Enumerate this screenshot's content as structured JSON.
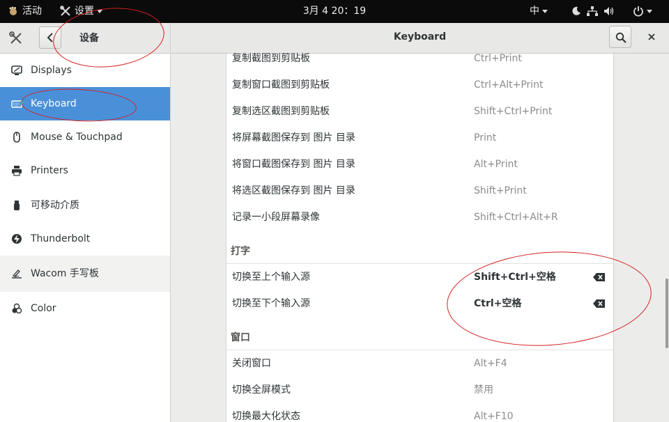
{
  "topbar": {
    "activities": "活动",
    "app_menu": "设置",
    "clock": "3月 4  20：19",
    "input_method": "中"
  },
  "header": {
    "section": "设备",
    "title": "Keyboard"
  },
  "sidebar": {
    "items": [
      {
        "label": "Displays",
        "icon": "display-icon"
      },
      {
        "label": "Keyboard",
        "icon": "keyboard-icon"
      },
      {
        "label": "Mouse & Touchpad",
        "icon": "mouse-icon"
      },
      {
        "label": "Printers",
        "icon": "printer-icon"
      },
      {
        "label": "可移动介质",
        "icon": "usb-icon"
      },
      {
        "label": "Thunderbolt",
        "icon": "thunderbolt-icon"
      },
      {
        "label": "Wacom 手写板",
        "icon": "tablet-icon"
      },
      {
        "label": "Color",
        "icon": "color-icon"
      }
    ]
  },
  "shortcuts": {
    "screenshots": [
      {
        "name": "复制截图到剪贴板",
        "accel": "Ctrl+Print"
      },
      {
        "name": "复制窗口截图到剪贴板",
        "accel": "Ctrl+Alt+Print"
      },
      {
        "name": "复制选区截图到剪贴板",
        "accel": "Shift+Ctrl+Print"
      },
      {
        "name": "将屏幕截图保存到 图片 目录",
        "accel": "Print"
      },
      {
        "name": "将窗口截图保存到 图片 目录",
        "accel": "Alt+Print"
      },
      {
        "name": "将选区截图保存到 图片 目录",
        "accel": "Shift+Print"
      },
      {
        "name": "记录一小段屏幕录像",
        "accel": "Shift+Ctrl+Alt+R"
      }
    ],
    "typing_group": "打字",
    "typing": [
      {
        "name": "切换至上个输入源",
        "accel": "Shift+Ctrl+空格"
      },
      {
        "name": "切换至下个输入源",
        "accel": "Ctrl+空格"
      }
    ],
    "windows_group": "窗口",
    "windows": [
      {
        "name": "关闭窗口",
        "accel": "Alt+F4"
      },
      {
        "name": "切换全屏模式",
        "accel": "禁用"
      },
      {
        "name": "切换最大化状态",
        "accel": "Alt+F10"
      }
    ]
  },
  "colors": {
    "accent": "#4a90d9",
    "topbar": "#0b0b0b",
    "annotation": "#d41e1e"
  }
}
